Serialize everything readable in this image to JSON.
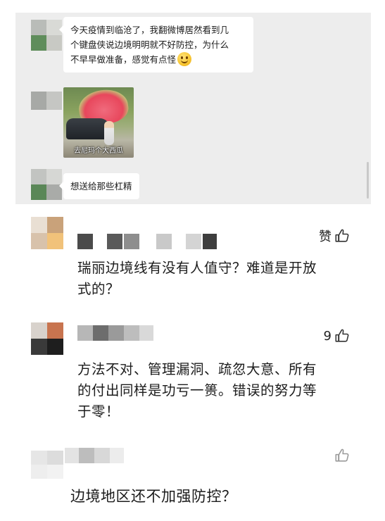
{
  "chat": {
    "messages": [
      {
        "type": "text",
        "text_line1": "今天疫情到临沧了，我翻微博居然看到几",
        "text_line2": "个键盘侠说边境明明就不好防控，为什么",
        "text_line3": "不早早做准备，感觉有点怪",
        "emoji": "smile-emoji"
      },
      {
        "type": "sticker",
        "caption": "去尼玛个大西瓜"
      },
      {
        "type": "text",
        "text_line1": "想送给那些杠精"
      }
    ]
  },
  "comments": [
    {
      "likes_label": "赞",
      "text_line1": "瑞丽边境线有没有人值守？难道是开放",
      "text_line2": "式的？"
    },
    {
      "likes_label": "9",
      "text_line1": "方法不对、管理漏洞、疏忽大意、所有",
      "text_line2": "的付出同样是功亏一篑。错误的努力等",
      "text_line3": "于零！"
    },
    {
      "likes_label": "",
      "text_line1": "边境地区还不加强防控？"
    }
  ],
  "icons": {
    "like": "thumbs-up-icon"
  },
  "colors": {
    "chat_bg": "#ededed",
    "bubble_bg": "#ffffff",
    "text": "#1c1c1c"
  }
}
